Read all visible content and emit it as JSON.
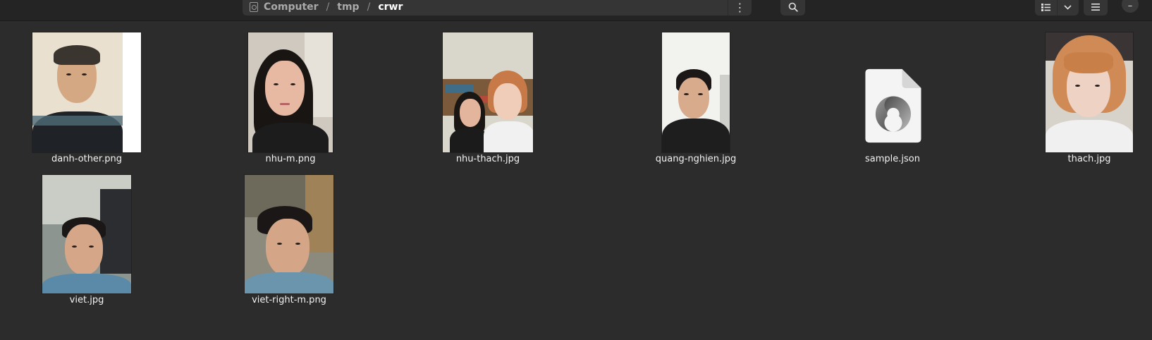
{
  "window": {
    "path": {
      "segments": [
        "Computer",
        "tmp",
        "crwr"
      ]
    }
  },
  "files": [
    {
      "name": "danh-other.png",
      "kind": "photo"
    },
    {
      "name": "nhu-m.png",
      "kind": "photo"
    },
    {
      "name": "nhu-thach.jpg",
      "kind": "photo"
    },
    {
      "name": "quang-nghien.jpg",
      "kind": "photo"
    },
    {
      "name": "sample.json",
      "kind": "json-document"
    },
    {
      "name": "thach.jpg",
      "kind": "photo"
    },
    {
      "name": "viet.jpg",
      "kind": "photo"
    },
    {
      "name": "viet-right-m.png",
      "kind": "photo"
    }
  ],
  "icons": {
    "drive": "drive-icon",
    "menu": "vertical-dots-icon",
    "search": "search-icon",
    "list_view": "list-view-icon",
    "view_options": "chevron-down-icon",
    "main_menu": "hamburger-menu-icon",
    "minimize": "minimize-icon",
    "json": "json-file-icon"
  },
  "colors": {
    "background": "#2c2c2c",
    "headerbar": "#242424",
    "text": "#f2f2f2"
  }
}
